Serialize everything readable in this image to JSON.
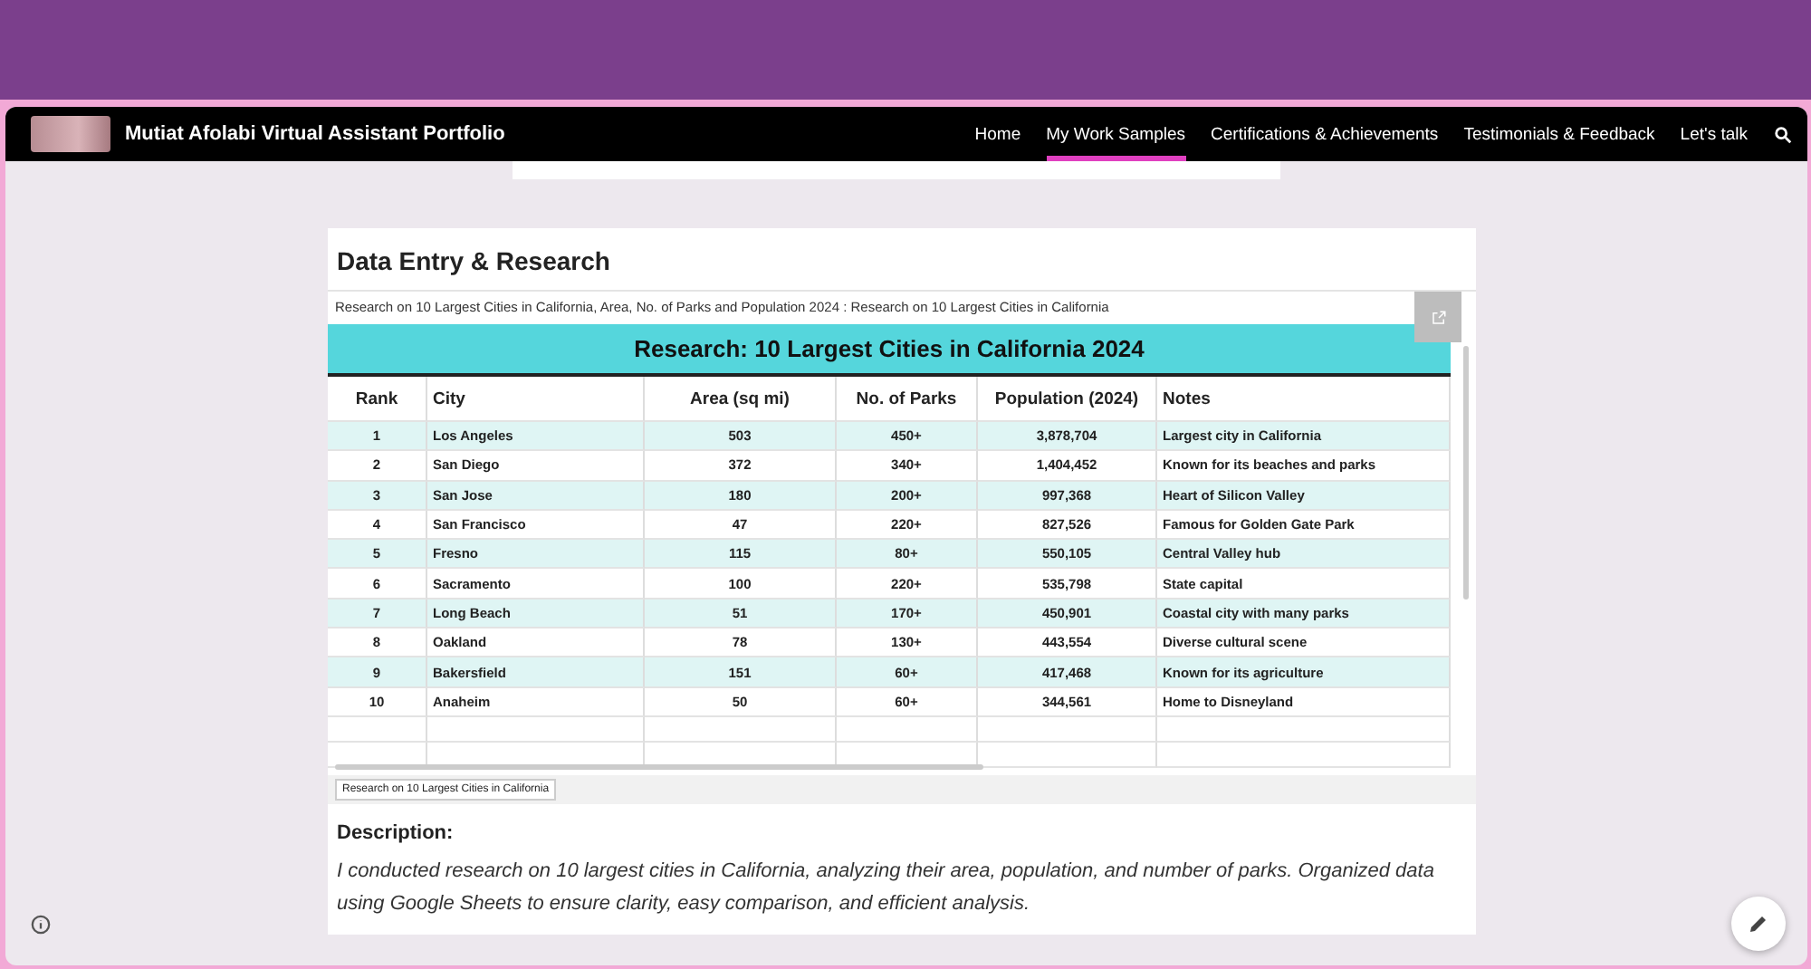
{
  "site": {
    "title": "Mutiat Afolabi Virtual Assistant Portfolio",
    "nav": [
      {
        "label": "Home",
        "selected": false
      },
      {
        "label": "My Work Samples",
        "selected": true
      },
      {
        "label": "Certifications & Achievements",
        "selected": false
      },
      {
        "label": "Testimonials & Feedback",
        "selected": false
      },
      {
        "label": "Let's talk",
        "selected": false
      }
    ]
  },
  "section": {
    "heading": "Data Entry & Research",
    "embed": {
      "doc_title": "Research on 10 Largest Cities in California, Area, No. of Parks and Population 2024 : Research on 10 Largest Cities in California",
      "sheet_title": "Research: 10 Largest Cities in California 2024",
      "columns": [
        "Rank",
        "City",
        "Area (sq mi)",
        "No. of Parks",
        "Population (2024)",
        "Notes"
      ],
      "rows": [
        [
          "1",
          "Los Angeles",
          "503",
          "450+",
          "3,878,704",
          "Largest city in California"
        ],
        [
          "2",
          "San Diego",
          "372",
          "340+",
          "1,404,452",
          "Known for its beaches and parks"
        ],
        [
          "3",
          "San Jose",
          "180",
          "200+",
          "997,368",
          "Heart of Silicon Valley"
        ],
        [
          "4",
          "San Francisco",
          "47",
          "220+",
          "827,526",
          "Famous for Golden Gate Park"
        ],
        [
          "5",
          "Fresno",
          "115",
          "80+",
          "550,105",
          "Central Valley hub"
        ],
        [
          "6",
          "Sacramento",
          "100",
          "220+",
          "535,798",
          "State capital"
        ],
        [
          "7",
          "Long Beach",
          "51",
          "170+",
          "450,901",
          "Coastal city with many parks"
        ],
        [
          "8",
          "Oakland",
          "78",
          "130+",
          "443,554",
          "Diverse cultural scene"
        ],
        [
          "9",
          "Bakersfield",
          "151",
          "60+",
          "417,468",
          "Known for its agriculture"
        ],
        [
          "10",
          "Anaheim",
          "50",
          "60+",
          "344,561",
          "Home to Disneyland"
        ]
      ],
      "sheet_tab": "Research on 10 Largest Cities in California"
    },
    "description_label": "Description:",
    "description": "I conducted research on 10 largest cities in California, analyzing their area, population, and number of parks. Organized data using Google Sheets to ensure clarity, easy comparison, and efficient analysis."
  }
}
